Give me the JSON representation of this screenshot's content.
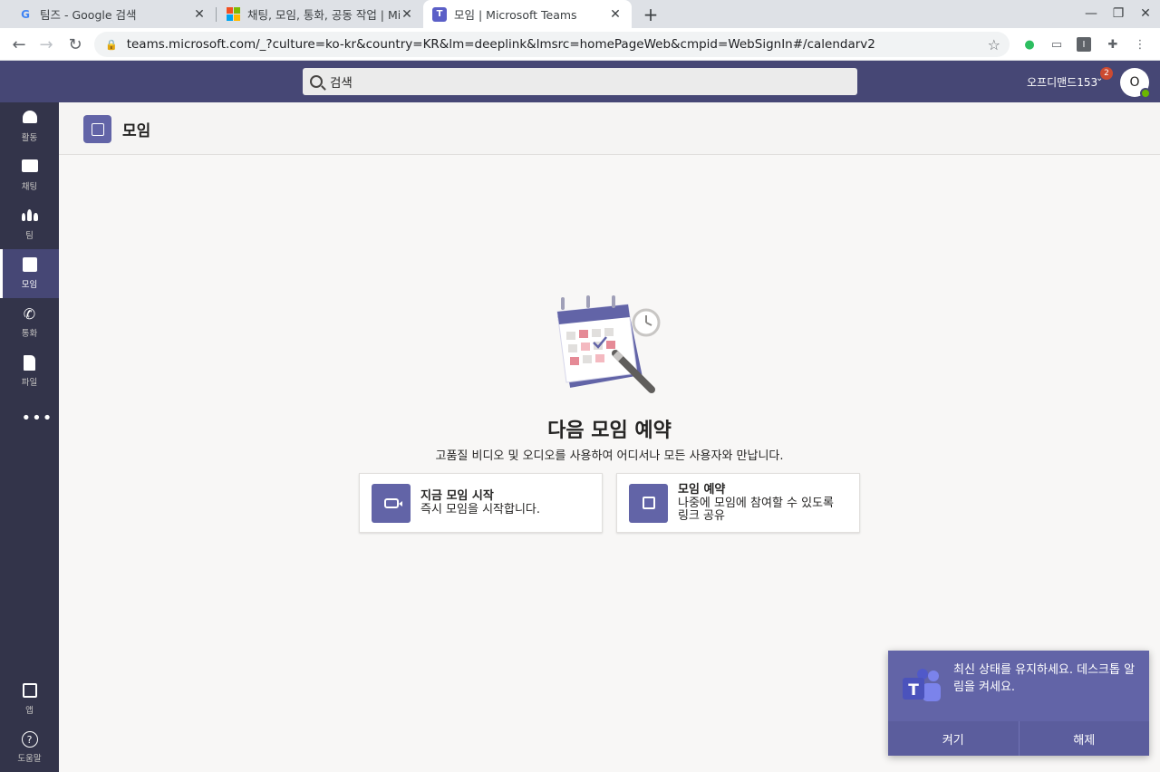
{
  "browser": {
    "tabs": [
      {
        "title": "팀즈 - Google 검색",
        "favicon": "google-icon"
      },
      {
        "title": "채팅, 모임, 통화, 공동 작업 | Microsoft Teams",
        "favicon": "microsoft-icon"
      },
      {
        "title": "모임 | Microsoft Teams",
        "favicon": "teams-icon",
        "active": true
      }
    ],
    "url": "teams.microsoft.com/_?culture=ko-kr&country=KR&lm=deeplink&lmsrc=homePageWeb&cmpid=WebSignIn#/calendarv2",
    "google_letter": "G",
    "new_tab": "+",
    "close": "✕"
  },
  "header": {
    "search_placeholder": "검색",
    "org_name": "오프디맨드153",
    "notification_count": "2",
    "avatar_initial": "O"
  },
  "rail": {
    "items": [
      {
        "label": "활동",
        "icon": "bell-icon"
      },
      {
        "label": "채팅",
        "icon": "chat-icon"
      },
      {
        "label": "팀",
        "icon": "teams-icon"
      },
      {
        "label": "모임",
        "icon": "calendar-icon",
        "active": true
      },
      {
        "label": "통화",
        "icon": "phone-icon"
      },
      {
        "label": "파일",
        "icon": "file-icon"
      }
    ],
    "more": "•••",
    "apps_label": "앱",
    "help_label": "도움말"
  },
  "page": {
    "title": "모임"
  },
  "main": {
    "hero_title": "다음 모임 예약",
    "hero_subtitle": "고품질 비디오 및 오디오를 사용하여 어디서나 모든 사용자와 만납니다.",
    "cards": [
      {
        "title": "지금 모임 시작",
        "description": "즉시 모임을 시작합니다."
      },
      {
        "title": "모임 예약",
        "description_line1": "나중에 모임에 참여할 수 있도록",
        "description_line2": "링크 공유"
      }
    ]
  },
  "toast": {
    "message": "최신 상태를 유지하세요. 데스크톱 알림을 켜세요.",
    "confirm_label": "켜기",
    "dismiss_label": "해제"
  },
  "colors": {
    "teams_header": "#464775",
    "rail": "#33344a",
    "accent": "#6264a7",
    "badge": "#cc4a31"
  }
}
